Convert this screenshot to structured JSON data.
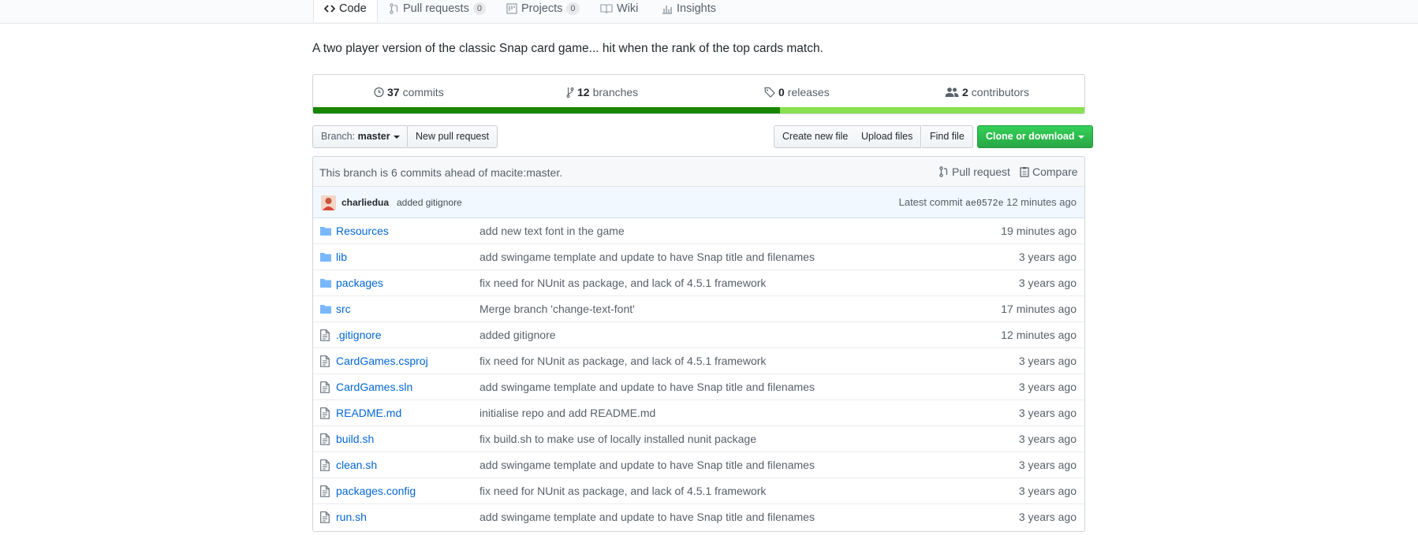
{
  "nav": {
    "tabs": [
      {
        "label": "Code"
      },
      {
        "label": "Pull requests",
        "count": "0"
      },
      {
        "label": "Projects",
        "count": "0"
      },
      {
        "label": "Wiki"
      },
      {
        "label": "Insights"
      }
    ]
  },
  "repo": {
    "description": "A two player version of the classic Snap card game... hit when the rank of the top cards match."
  },
  "summary": {
    "commits_count": "37",
    "commits_label": "commits",
    "branches_count": "12",
    "branches_label": "branches",
    "releases_count": "0",
    "releases_label": "releases",
    "contributors_count": "2",
    "contributors_label": "contributors",
    "language_bar": [
      {
        "fraction": 0.605,
        "color": "#178600"
      },
      {
        "fraction": 0.395,
        "color": "#89e051"
      }
    ]
  },
  "toolbar": {
    "branch_prefix": "Branch:",
    "branch_name": "master",
    "new_pull_request": "New pull request",
    "create_new_file": "Create new file",
    "upload_files": "Upload files",
    "find_file": "Find file",
    "clone_or_download": "Clone or download"
  },
  "branch_status": {
    "text": "This branch is 6 commits ahead of macite:master.",
    "pull_request": "Pull request",
    "compare": "Compare"
  },
  "latest_commit": {
    "author": "charliedua",
    "message": "added gitignore",
    "label": "Latest commit",
    "sha": "ae0572e",
    "age": "12 minutes ago"
  },
  "files": [
    {
      "type": "dir",
      "name": "Resources",
      "message": "add new text font in the game",
      "age": "19 minutes ago"
    },
    {
      "type": "dir",
      "name": "lib",
      "message": "add swingame template and update to have Snap title and filenames",
      "age": "3 years ago"
    },
    {
      "type": "dir",
      "name": "packages",
      "message": "fix need for NUnit as package, and lack of 4.5.1 framework",
      "age": "3 years ago"
    },
    {
      "type": "dir",
      "name": "src",
      "message": "Merge branch 'change-text-font'",
      "age": "17 minutes ago"
    },
    {
      "type": "file",
      "name": ".gitignore",
      "message": "added gitignore",
      "age": "12 minutes ago"
    },
    {
      "type": "file",
      "name": "CardGames.csproj",
      "message": "fix need for NUnit as package, and lack of 4.5.1 framework",
      "age": "3 years ago"
    },
    {
      "type": "file",
      "name": "CardGames.sln",
      "message": "add swingame template and update to have Snap title and filenames",
      "age": "3 years ago"
    },
    {
      "type": "file",
      "name": "README.md",
      "message": "initialise repo and add README.md",
      "age": "3 years ago"
    },
    {
      "type": "file",
      "name": "build.sh",
      "message": "fix build.sh to make use of locally installed nunit package",
      "age": "3 years ago"
    },
    {
      "type": "file",
      "name": "clean.sh",
      "message": "add swingame template and update to have Snap title and filenames",
      "age": "3 years ago"
    },
    {
      "type": "file",
      "name": "packages.config",
      "message": "fix need for NUnit as package, and lack of 4.5.1 framework",
      "age": "3 years ago"
    },
    {
      "type": "file",
      "name": "run.sh",
      "message": "add swingame template and update to have Snap title and filenames",
      "age": "3 years ago"
    }
  ]
}
